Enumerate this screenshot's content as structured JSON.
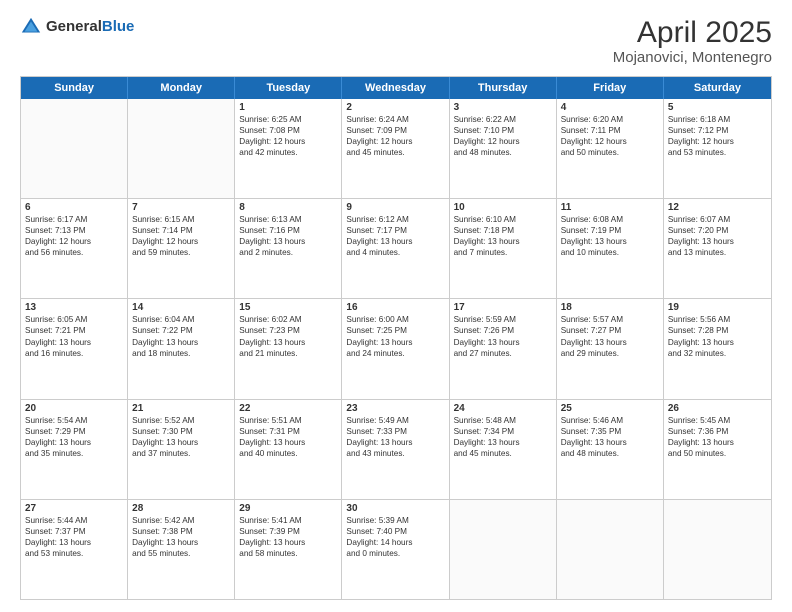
{
  "header": {
    "logo_general": "General",
    "logo_blue": "Blue",
    "title": "April 2025",
    "subtitle": "Mojanovici, Montenegro"
  },
  "weekdays": [
    "Sunday",
    "Monday",
    "Tuesday",
    "Wednesday",
    "Thursday",
    "Friday",
    "Saturday"
  ],
  "rows": [
    [
      {
        "day": "",
        "lines": []
      },
      {
        "day": "",
        "lines": []
      },
      {
        "day": "1",
        "lines": [
          "Sunrise: 6:25 AM",
          "Sunset: 7:08 PM",
          "Daylight: 12 hours",
          "and 42 minutes."
        ]
      },
      {
        "day": "2",
        "lines": [
          "Sunrise: 6:24 AM",
          "Sunset: 7:09 PM",
          "Daylight: 12 hours",
          "and 45 minutes."
        ]
      },
      {
        "day": "3",
        "lines": [
          "Sunrise: 6:22 AM",
          "Sunset: 7:10 PM",
          "Daylight: 12 hours",
          "and 48 minutes."
        ]
      },
      {
        "day": "4",
        "lines": [
          "Sunrise: 6:20 AM",
          "Sunset: 7:11 PM",
          "Daylight: 12 hours",
          "and 50 minutes."
        ]
      },
      {
        "day": "5",
        "lines": [
          "Sunrise: 6:18 AM",
          "Sunset: 7:12 PM",
          "Daylight: 12 hours",
          "and 53 minutes."
        ]
      }
    ],
    [
      {
        "day": "6",
        "lines": [
          "Sunrise: 6:17 AM",
          "Sunset: 7:13 PM",
          "Daylight: 12 hours",
          "and 56 minutes."
        ]
      },
      {
        "day": "7",
        "lines": [
          "Sunrise: 6:15 AM",
          "Sunset: 7:14 PM",
          "Daylight: 12 hours",
          "and 59 minutes."
        ]
      },
      {
        "day": "8",
        "lines": [
          "Sunrise: 6:13 AM",
          "Sunset: 7:16 PM",
          "Daylight: 13 hours",
          "and 2 minutes."
        ]
      },
      {
        "day": "9",
        "lines": [
          "Sunrise: 6:12 AM",
          "Sunset: 7:17 PM",
          "Daylight: 13 hours",
          "and 4 minutes."
        ]
      },
      {
        "day": "10",
        "lines": [
          "Sunrise: 6:10 AM",
          "Sunset: 7:18 PM",
          "Daylight: 13 hours",
          "and 7 minutes."
        ]
      },
      {
        "day": "11",
        "lines": [
          "Sunrise: 6:08 AM",
          "Sunset: 7:19 PM",
          "Daylight: 13 hours",
          "and 10 minutes."
        ]
      },
      {
        "day": "12",
        "lines": [
          "Sunrise: 6:07 AM",
          "Sunset: 7:20 PM",
          "Daylight: 13 hours",
          "and 13 minutes."
        ]
      }
    ],
    [
      {
        "day": "13",
        "lines": [
          "Sunrise: 6:05 AM",
          "Sunset: 7:21 PM",
          "Daylight: 13 hours",
          "and 16 minutes."
        ]
      },
      {
        "day": "14",
        "lines": [
          "Sunrise: 6:04 AM",
          "Sunset: 7:22 PM",
          "Daylight: 13 hours",
          "and 18 minutes."
        ]
      },
      {
        "day": "15",
        "lines": [
          "Sunrise: 6:02 AM",
          "Sunset: 7:23 PM",
          "Daylight: 13 hours",
          "and 21 minutes."
        ]
      },
      {
        "day": "16",
        "lines": [
          "Sunrise: 6:00 AM",
          "Sunset: 7:25 PM",
          "Daylight: 13 hours",
          "and 24 minutes."
        ]
      },
      {
        "day": "17",
        "lines": [
          "Sunrise: 5:59 AM",
          "Sunset: 7:26 PM",
          "Daylight: 13 hours",
          "and 27 minutes."
        ]
      },
      {
        "day": "18",
        "lines": [
          "Sunrise: 5:57 AM",
          "Sunset: 7:27 PM",
          "Daylight: 13 hours",
          "and 29 minutes."
        ]
      },
      {
        "day": "19",
        "lines": [
          "Sunrise: 5:56 AM",
          "Sunset: 7:28 PM",
          "Daylight: 13 hours",
          "and 32 minutes."
        ]
      }
    ],
    [
      {
        "day": "20",
        "lines": [
          "Sunrise: 5:54 AM",
          "Sunset: 7:29 PM",
          "Daylight: 13 hours",
          "and 35 minutes."
        ]
      },
      {
        "day": "21",
        "lines": [
          "Sunrise: 5:52 AM",
          "Sunset: 7:30 PM",
          "Daylight: 13 hours",
          "and 37 minutes."
        ]
      },
      {
        "day": "22",
        "lines": [
          "Sunrise: 5:51 AM",
          "Sunset: 7:31 PM",
          "Daylight: 13 hours",
          "and 40 minutes."
        ]
      },
      {
        "day": "23",
        "lines": [
          "Sunrise: 5:49 AM",
          "Sunset: 7:33 PM",
          "Daylight: 13 hours",
          "and 43 minutes."
        ]
      },
      {
        "day": "24",
        "lines": [
          "Sunrise: 5:48 AM",
          "Sunset: 7:34 PM",
          "Daylight: 13 hours",
          "and 45 minutes."
        ]
      },
      {
        "day": "25",
        "lines": [
          "Sunrise: 5:46 AM",
          "Sunset: 7:35 PM",
          "Daylight: 13 hours",
          "and 48 minutes."
        ]
      },
      {
        "day": "26",
        "lines": [
          "Sunrise: 5:45 AM",
          "Sunset: 7:36 PM",
          "Daylight: 13 hours",
          "and 50 minutes."
        ]
      }
    ],
    [
      {
        "day": "27",
        "lines": [
          "Sunrise: 5:44 AM",
          "Sunset: 7:37 PM",
          "Daylight: 13 hours",
          "and 53 minutes."
        ]
      },
      {
        "day": "28",
        "lines": [
          "Sunrise: 5:42 AM",
          "Sunset: 7:38 PM",
          "Daylight: 13 hours",
          "and 55 minutes."
        ]
      },
      {
        "day": "29",
        "lines": [
          "Sunrise: 5:41 AM",
          "Sunset: 7:39 PM",
          "Daylight: 13 hours",
          "and 58 minutes."
        ]
      },
      {
        "day": "30",
        "lines": [
          "Sunrise: 5:39 AM",
          "Sunset: 7:40 PM",
          "Daylight: 14 hours",
          "and 0 minutes."
        ]
      },
      {
        "day": "",
        "lines": []
      },
      {
        "day": "",
        "lines": []
      },
      {
        "day": "",
        "lines": []
      }
    ]
  ]
}
